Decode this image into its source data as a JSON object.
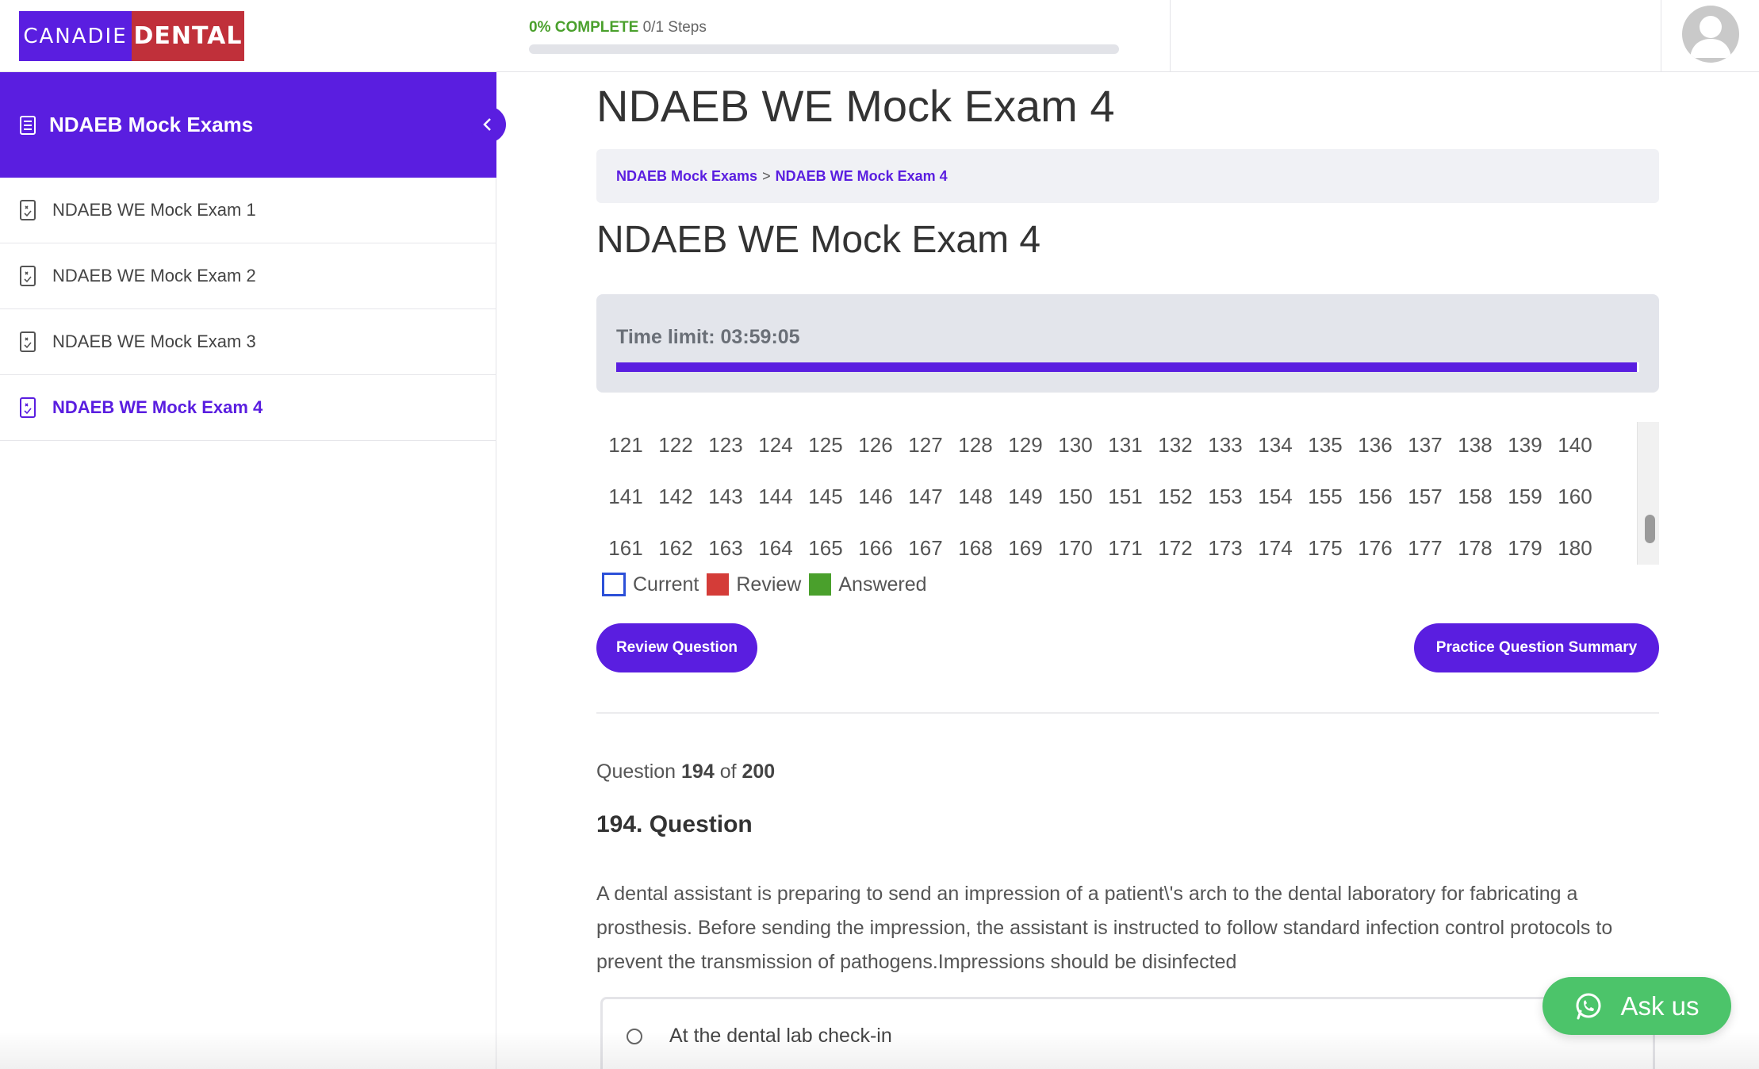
{
  "logo": {
    "left_text": "CANADIE",
    "right_text": "DENTAL"
  },
  "progress": {
    "percent_label": "0% COMPLETE",
    "steps_label": "0/1 Steps",
    "value_fraction": 0.0
  },
  "sidebar": {
    "header_title": "NDAEB Mock Exams",
    "items": [
      {
        "label": "NDAEB WE Mock Exam 1",
        "active": false
      },
      {
        "label": "NDAEB WE Mock Exam 2",
        "active": false
      },
      {
        "label": "NDAEB WE Mock Exam 3",
        "active": false
      },
      {
        "label": "NDAEB WE Mock Exam 4",
        "active": true
      }
    ]
  },
  "main": {
    "page_title": "NDAEB WE Mock Exam 4",
    "breadcrumb": {
      "parent": "NDAEB Mock Exams",
      "separator": ">",
      "current": "NDAEB WE Mock Exam 4"
    },
    "section_title": "NDAEB WE Mock Exam 4",
    "timer": {
      "label": "Time limit: 03:59:05",
      "remaining_fraction": 0.998
    },
    "question_numbers": [
      "121",
      "122",
      "123",
      "124",
      "125",
      "126",
      "127",
      "128",
      "129",
      "130",
      "131",
      "132",
      "133",
      "134",
      "135",
      "136",
      "137",
      "138",
      "139",
      "140",
      "141",
      "142",
      "143",
      "144",
      "145",
      "146",
      "147",
      "148",
      "149",
      "150",
      "151",
      "152",
      "153",
      "154",
      "155",
      "156",
      "157",
      "158",
      "159",
      "160",
      "161",
      "162",
      "163",
      "164",
      "165",
      "166",
      "167",
      "168",
      "169",
      "170",
      "171",
      "172",
      "173",
      "174",
      "175",
      "176",
      "177",
      "178",
      "179",
      "180"
    ],
    "legend": {
      "current": "Current",
      "review": "Review",
      "answered": "Answered"
    },
    "buttons": {
      "review": "Review Question",
      "summary": "Practice Question Summary"
    },
    "question": {
      "count_prefix": "Question",
      "current": "194",
      "count_of": "of",
      "total": "200",
      "title": "194. Question",
      "text": "A dental assistant is preparing to send an impression of a patient\\'s arch to the dental laboratory for fabricating a prosthesis. Before sending the impression, the assistant is instructed to follow standard infection control protocols to prevent the transmission of pathogens.Impressions should be disinfected",
      "answer_1": "At the dental lab check-in"
    }
  },
  "chat": {
    "label": "Ask us"
  },
  "colors": {
    "brand_purple": "#5a1ee0",
    "brand_red": "#c0303a",
    "success_green": "#4aa02c",
    "review_red": "#d43c38",
    "current_blue": "#2c50d8",
    "chat_green": "#4cc46a"
  },
  "icons": {
    "sidebar_header": "document-list-icon",
    "sidebar_item": "quiz-icon",
    "collapse": "chevron-left-icon",
    "avatar": "user-avatar-icon",
    "chat": "whatsapp-icon"
  }
}
